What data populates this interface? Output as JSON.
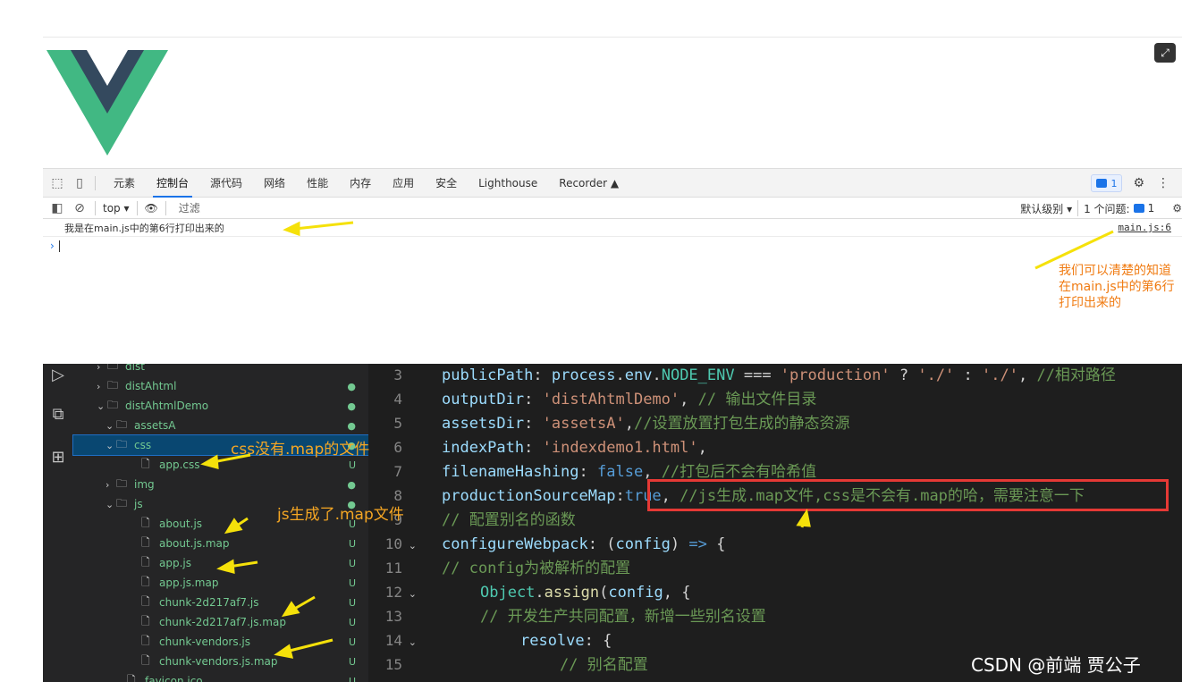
{
  "devtools": {
    "tabs": [
      "元素",
      "控制台",
      "源代码",
      "网络",
      "性能",
      "内存",
      "应用",
      "安全",
      "Lighthouse",
      "Recorder ▲"
    ],
    "active_tab": "控制台",
    "issues_badge": "1",
    "context": "top ▾",
    "filter_placeholder": "过滤",
    "level": "默认级别 ▾",
    "issues_label": "1 个问题:",
    "issues_count": "1",
    "console_message": "我是在main.js中的第6行打印出来的",
    "console_source": "main.js:6",
    "prompt": "›"
  },
  "annotations": {
    "devtools_note": "我们可以清楚的知道在main.js中的第6行打印出来的",
    "css_note": "css没有.map的文件",
    "js_note": "js生成了.map文件"
  },
  "explorer": {
    "items": [
      {
        "label": "dist",
        "badge": ""
      },
      {
        "label": "distAhtml",
        "badge": "●"
      },
      {
        "label": "distAhtmlDemo",
        "badge": "●"
      },
      {
        "label": "assetsA",
        "badge": "●"
      },
      {
        "label": "css",
        "badge": "●"
      },
      {
        "label": "app.css",
        "badge": "U"
      },
      {
        "label": "img",
        "badge": "●"
      },
      {
        "label": "js",
        "badge": "●"
      },
      {
        "label": "about.js",
        "badge": "U"
      },
      {
        "label": "about.js.map",
        "badge": "U"
      },
      {
        "label": "app.js",
        "badge": "U"
      },
      {
        "label": "app.js.map",
        "badge": "U"
      },
      {
        "label": "chunk-2d217af7.js",
        "badge": "U"
      },
      {
        "label": "chunk-2d217af7.js.map",
        "badge": "U"
      },
      {
        "label": "chunk-vendors.js",
        "badge": "U"
      },
      {
        "label": "chunk-vendors.js.map",
        "badge": "U"
      },
      {
        "label": "favicon.ico",
        "badge": "U"
      }
    ]
  },
  "editor": {
    "line_numbers": [
      "3",
      "4",
      "5",
      "6",
      "7",
      "8",
      "9",
      "10",
      "11",
      "12",
      "13",
      "14",
      "15"
    ],
    "lines": [
      "publicPath: process.env.NODE_ENV === 'production' ? './' : './', //相对路径",
      "outputDir: 'distAhtmlDemo', // 输出文件目录",
      "assetsDir: 'assetsA',//设置放置打包生成的静态资源",
      "indexPath: 'indexdemo1.html',",
      "filenameHashing: false, //打包后不会有哈希值",
      "productionSourceMap:true, //js生成.map文件,css是不会有.map的哈，需要注意一下",
      "// 配置别名的函数",
      "configureWebpack: (config) => {",
      "// config为被解析的配置",
      "Object.assign(config, {",
      "// 开发生产共同配置，新增一些别名设置",
      "resolve: {",
      "// 别名配置"
    ]
  },
  "watermark": "CSDN @前端 贾公子",
  "colors": {
    "annotation_orange": "#f5a623",
    "red_box": "#e53935",
    "vue_green": "#41b883",
    "vue_dark": "#34495e"
  }
}
